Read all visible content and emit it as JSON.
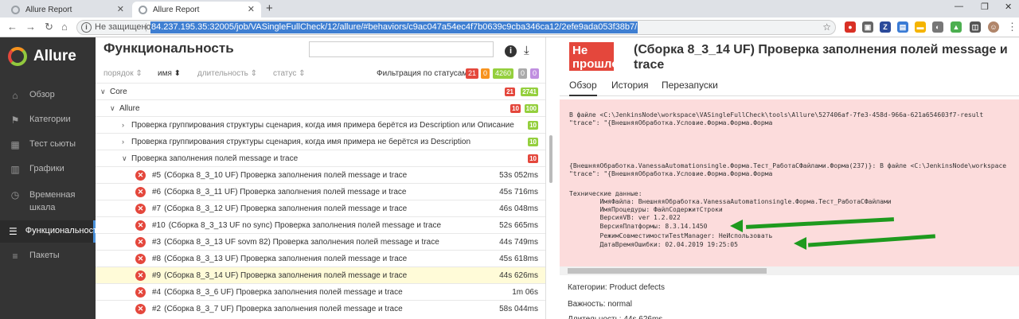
{
  "browser": {
    "tabs": [
      {
        "title": "Allure Report"
      },
      {
        "title": "Allure Report"
      }
    ],
    "not_secure": "Не защищено",
    "url": "84.237.195.35:32005/job/VASingleFullCheck/12/allure/#behaviors/c9ac047a54ec4f7b0639c9cba346ca12/2efe9ada053f38b7/"
  },
  "sidebar": {
    "brand": "Allure",
    "items": [
      {
        "label": "Обзор",
        "icon": "home-icon"
      },
      {
        "label": "Категории",
        "icon": "flag-icon"
      },
      {
        "label": "Тест сьюты",
        "icon": "briefcase-icon"
      },
      {
        "label": "Графики",
        "icon": "bar-chart-icon"
      },
      {
        "label": "Временная шкала",
        "icon": "clock-icon"
      },
      {
        "label": "Функциональность",
        "icon": "list-icon"
      },
      {
        "label": "Пакеты",
        "icon": "layers-icon"
      }
    ]
  },
  "tree": {
    "title": "Функциональность",
    "sort": {
      "order": "порядок",
      "name": "имя",
      "duration": "длительность",
      "status": "статус"
    },
    "filter_label": "Фильтрация по статусам:",
    "filter_counts": [
      "21",
      "0",
      "4260",
      "0",
      "0"
    ],
    "core": {
      "label": "Core",
      "failed": "21",
      "passed": "2741"
    },
    "allure": {
      "label": "Allure",
      "failed": "10",
      "passed": "100"
    },
    "groups": [
      {
        "label": "Проверка группирования структуры сценария, когда имя примера берётся из Description или Описание",
        "count": "10"
      },
      {
        "label": "Проверка группирования структуры сценария, когда имя примера не берётся из Description",
        "count": "10"
      },
      {
        "label": "Проверка заполнения полей message и trace",
        "count": "10"
      }
    ],
    "tests": [
      {
        "num": "#5",
        "name": "(Сборка 8_3_10 UF) Проверка заполнения полей message и trace",
        "duration": "53s 052ms"
      },
      {
        "num": "#6",
        "name": "(Сборка 8_3_11 UF) Проверка заполнения полей message и trace",
        "duration": "45s 716ms"
      },
      {
        "num": "#7",
        "name": "(Сборка 8_3_12 UF) Проверка заполнения полей message и trace",
        "duration": "46s 048ms"
      },
      {
        "num": "#10",
        "name": "(Сборка 8_3_13 UF no sync) Проверка заполнения полей message и trace",
        "duration": "52s 665ms"
      },
      {
        "num": "#3",
        "name": "(Сборка 8_3_13 UF sovm 82) Проверка заполнения полей message и trace",
        "duration": "44s 749ms"
      },
      {
        "num": "#8",
        "name": "(Сборка 8_3_13 UF) Проверка заполнения полей message и trace",
        "duration": "45s 618ms"
      },
      {
        "num": "#9",
        "name": "(Сборка 8_3_14 UF) Проверка заполнения полей message и trace",
        "duration": "44s 626ms"
      },
      {
        "num": "#4",
        "name": "(Сборка 8_3_6 UF) Проверка заполнения полей message и trace",
        "duration": "1m 06s"
      },
      {
        "num": "#2",
        "name": "(Сборка 8_3_7 UF) Проверка заполнения полей message и trace",
        "duration": "58s 044ms"
      }
    ]
  },
  "detail": {
    "status_line1": "Не",
    "status_line2": "прошло",
    "title": "(Сборка 8_3_14 UF) Проверка заполнения полей message и trace",
    "tabs": [
      "Обзор",
      "История",
      "Перезапуски"
    ],
    "error_lines": [
      "В файле <C:\\JenkinsNode\\workspace\\VASingleFullCheck\\tools\\Allure\\527406af-7fe3-458d-966a-621a654603f7-result",
      "\"trace\": \"{ВнешняяОбработка.Условие.Форма.Форма.Форма",
      "{ВнешняяОбработка.VanessaAutomationsingle.Форма.Тест_РаботаСФайлами.Форма(237)}: В файле <C:\\JenkinsNode\\workspace",
      "\"trace\": \"{ВнешняяОбработка.Условие.Форма.Форма.Форма",
      "Технические данные:",
      "        ИмяФайла: ВнешняяОбработка.VanessaAutomationsingle.Форма.Тест_РаботаСФайлами",
      "        ИмяПроцедуры: ФайлСодержитСтроки",
      "        ВерсияVB: ver 1.2.022",
      "        ВерсияПлатформы: 8.3.14.1450",
      "        РежимСовместимостиTestManager: НеИспользовать",
      "        ДатаВремяОшибки: 02.04.2019 19:25:05"
    ],
    "categories": "Категории: Product defects",
    "severity": "Важность: normal",
    "partial": "Длительность: 44s 626ms"
  },
  "colors": {
    "failed": "#e4473c",
    "broken": "#f7931e",
    "passed": "#94cf3d",
    "skipped": "#aaaaaa",
    "unknown": "#c08fe0",
    "arrow": "#1e9a1e"
  }
}
